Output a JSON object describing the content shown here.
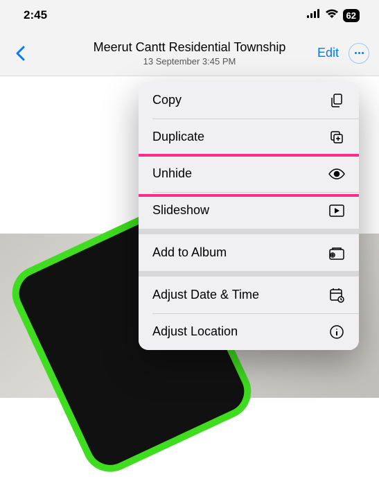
{
  "status": {
    "time": "2:45",
    "battery": "62"
  },
  "nav": {
    "title": "Meerut Cantt Residential Township",
    "subtitle": "13 September  3:45 PM",
    "edit": "Edit"
  },
  "menu": {
    "copy": "Copy",
    "duplicate": "Duplicate",
    "unhide": "Unhide",
    "slideshow": "Slideshow",
    "add_to_album": "Add to Album",
    "adjust_date_time": "Adjust Date & Time",
    "adjust_location": "Adjust Location"
  }
}
